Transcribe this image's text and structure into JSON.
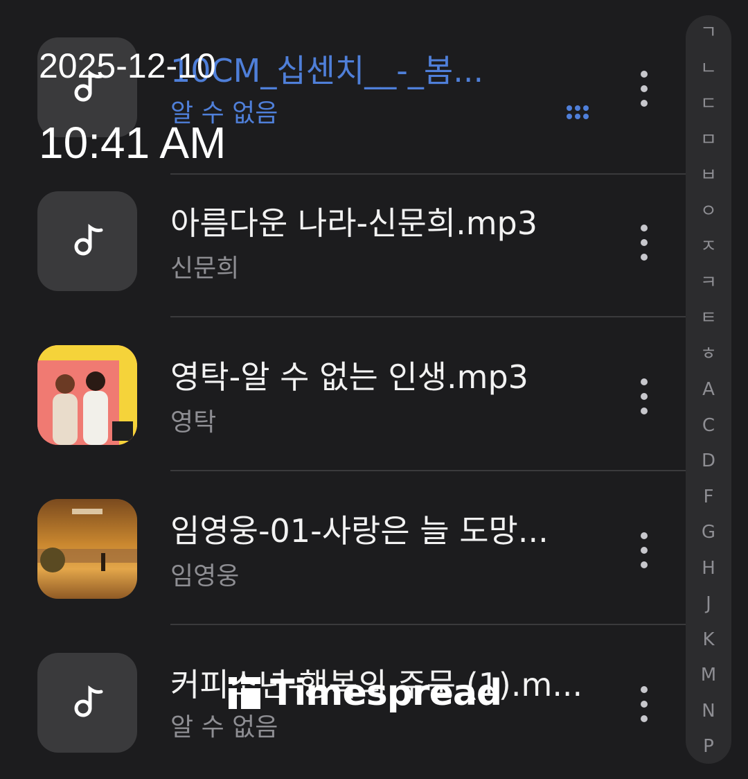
{
  "overlay": {
    "date": "2025-12-10",
    "time": "10:41 AM",
    "watermark": "Timespread"
  },
  "songs": [
    {
      "title": "10CM_십센치__-_봄...",
      "artist": "알 수 없음",
      "art": "music-note-icon",
      "playing": true
    },
    {
      "title": "아름다운 나라-신문희.mp3",
      "artist": "신문희",
      "art": "music-note-icon",
      "playing": false
    },
    {
      "title": "영탁-알 수 없는 인생.mp3",
      "artist": "영탁",
      "art": "album-art-image",
      "playing": false
    },
    {
      "title": "임영웅-01-사랑은 늘 도망...",
      "artist": "임영웅",
      "art": "album-art-image",
      "playing": false
    },
    {
      "title": "커피소년-행복의 주문 (1).m...",
      "artist": "알 수 없음",
      "art": "music-note-icon",
      "playing": false
    }
  ],
  "index": [
    "ㄱ",
    "ㄴ",
    "ㄷ",
    "ㅁ",
    "ㅂ",
    "ㅇ",
    "ㅈ",
    "ㅋ",
    "ㅌ",
    "ㅎ",
    "A",
    "C",
    "D",
    "F",
    "G",
    "H",
    "J",
    "K",
    "M",
    "N",
    "P"
  ],
  "colors": {
    "background": "#1c1c1e",
    "accent_playing": "#4f7fd9",
    "secondary_text": "#8e8e93",
    "index_bar": "#2c2c2e"
  }
}
